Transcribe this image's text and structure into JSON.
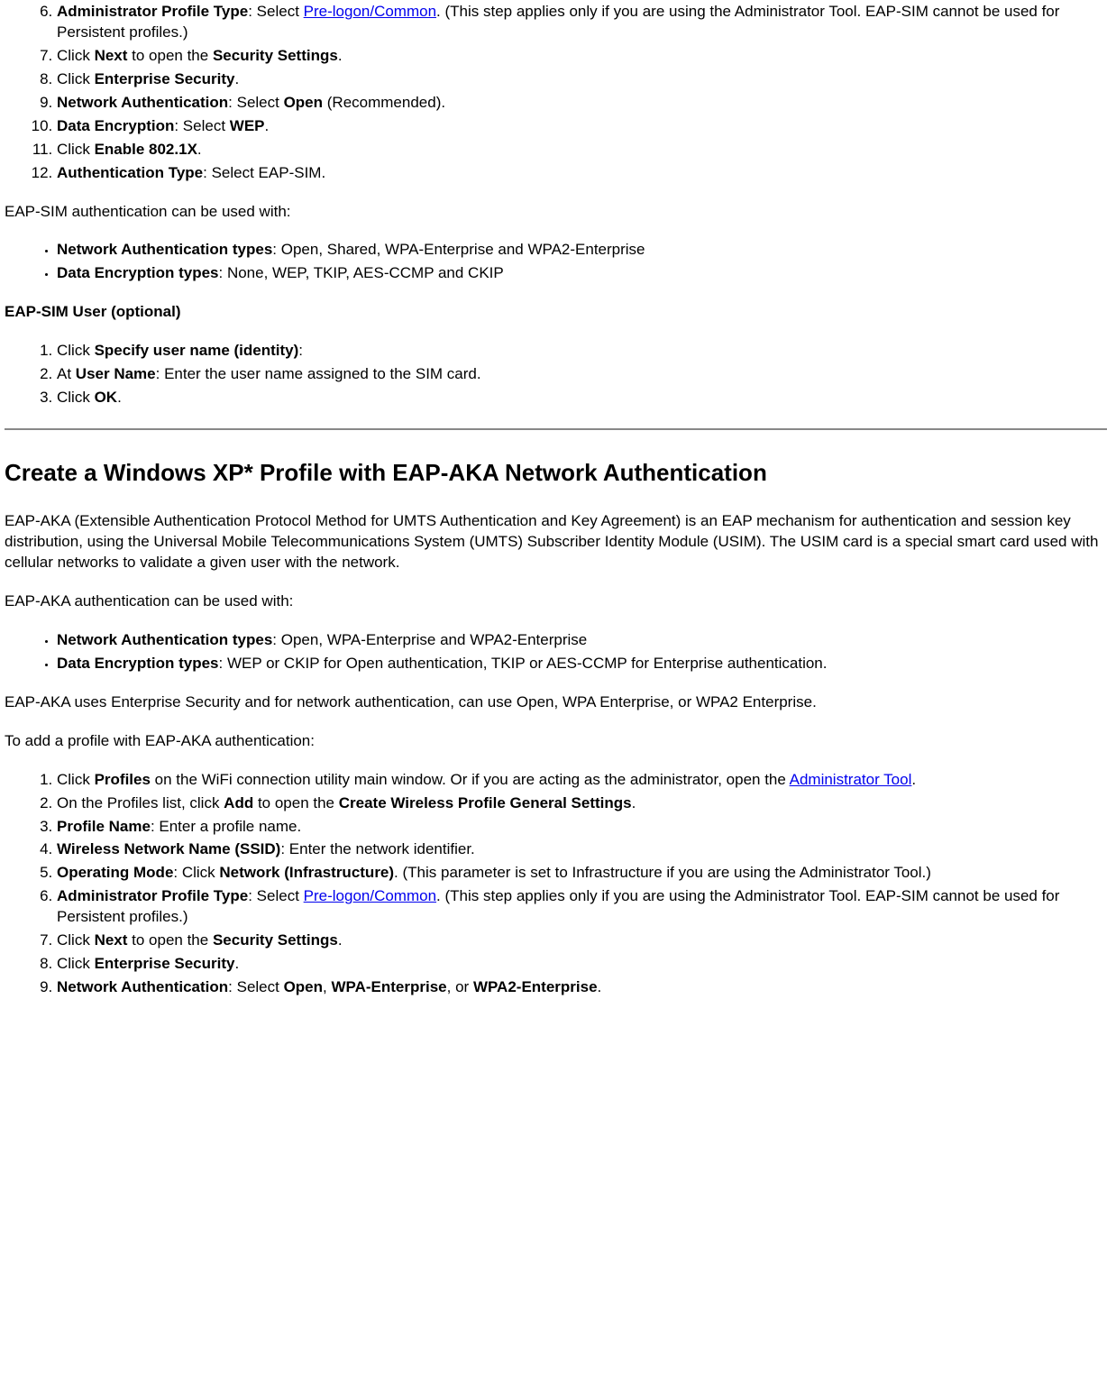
{
  "ol1": {
    "start": 6,
    "items": [
      {
        "pre": "Administrator Profile Type",
        "mid": ": Select ",
        "link": "Pre-logon/Common",
        "post": ". (This step applies only if you are using the Administrator Tool. EAP-SIM cannot be used for Persistent profiles.)"
      },
      {
        "t1": "Click ",
        "b1": "Next",
        "t2": " to open the ",
        "b2": "Security Settings",
        "t3": "."
      },
      {
        "t1": "Click ",
        "b1": "Enterprise Security",
        "t2": "."
      },
      {
        "b1": "Network Authentication",
        "t1": ": Select ",
        "b2": "Open",
        "t2": " (Recommended)."
      },
      {
        "b1": "Data Encryption",
        "t1": ": Select ",
        "b2": "WEP",
        "t2": "."
      },
      {
        "t1": "Click ",
        "b1": "Enable 802.1X",
        "t2": "."
      },
      {
        "b1": "Authentication Type",
        "t1": ": Select EAP-SIM."
      }
    ]
  },
  "p1": "EAP-SIM authentication can be used with:",
  "ul1": [
    {
      "b": "Network Authentication types",
      "t": ": Open, Shared, WPA-Enterprise and WPA2-Enterprise"
    },
    {
      "b": "Data Encryption types",
      "t": ": None, WEP, TKIP, AES-CCMP and CKIP"
    }
  ],
  "sub1": "EAP-SIM User (optional)",
  "ol2": [
    {
      "t1": "Click ",
      "b1": "Specify user name (identity)",
      "t2": ":"
    },
    {
      "t1": "At ",
      "b1": "User Name",
      "t2": ": Enter the user name assigned to the SIM card."
    },
    {
      "t1": "Click ",
      "b1": "OK",
      "t2": "."
    }
  ],
  "h2": "Create a Windows XP* Profile with EAP-AKA Network Authentication",
  "p2": "EAP-AKA (Extensible Authentication Protocol Method for UMTS Authentication and Key Agreement) is an EAP mechanism for authentication and session key distribution, using the Universal Mobile Telecommunications System (UMTS) Subscriber Identity Module (USIM). The USIM card is a special smart card used with cellular networks to validate a given user with the network.",
  "p3": "EAP-AKA authentication can be used with:",
  "ul2": [
    {
      "b": "Network Authentication types",
      "t": ": Open, WPA-Enterprise and WPA2-Enterprise"
    },
    {
      "b": "Data Encryption types",
      "t": ": WEP or CKIP for Open authentication, TKIP or AES-CCMP for Enterprise authentication."
    }
  ],
  "p4": "EAP-AKA uses Enterprise Security and for network authentication, can use Open, WPA Enterprise, or WPA2 Enterprise.",
  "p5": "To add a profile with EAP-AKA authentication:",
  "ol3": [
    {
      "t1": "Click ",
      "b1": "Profiles",
      "t2": " on the WiFi connection utility main window. Or if you are acting as the administrator, open the ",
      "link": "Administrator Tool",
      "t3": "."
    },
    {
      "t1": "On the Profiles list, click ",
      "b1": "Add",
      "t2": " to open the ",
      "b2": "Create Wireless Profile General Settings",
      "t3": "."
    },
    {
      "b1": "Profile Name",
      "t1": ": Enter a profile name."
    },
    {
      "b1": "Wireless Network Name (SSID)",
      "t1": ": Enter the network identifier."
    },
    {
      "b1": "Operating Mode",
      "t1": ": Click ",
      "b2": "Network (Infrastructure)",
      "t2": ". (This parameter is set to Infrastructure if you are using the Administrator Tool.)"
    },
    {
      "b1": "Administrator Profile Type",
      "t1": ": Select ",
      "link": "Pre-logon/Common",
      "t2": ". (This step applies only if you are using the Administrator Tool. EAP-SIM cannot be used for Persistent profiles.)"
    },
    {
      "t1": "Click ",
      "b1": "Next",
      "t2": " to open the ",
      "b2": "Security Settings",
      "t3": "."
    },
    {
      "t1": "Click ",
      "b1": "Enterprise Security",
      "t2": "."
    },
    {
      "b1": "Network Authentication",
      "t1": ": Select ",
      "b2": "Open",
      "t2": ", ",
      "b3": "WPA-Enterprise",
      "t3": ", or ",
      "b4": "WPA2-Enterprise",
      "t4": "."
    }
  ]
}
